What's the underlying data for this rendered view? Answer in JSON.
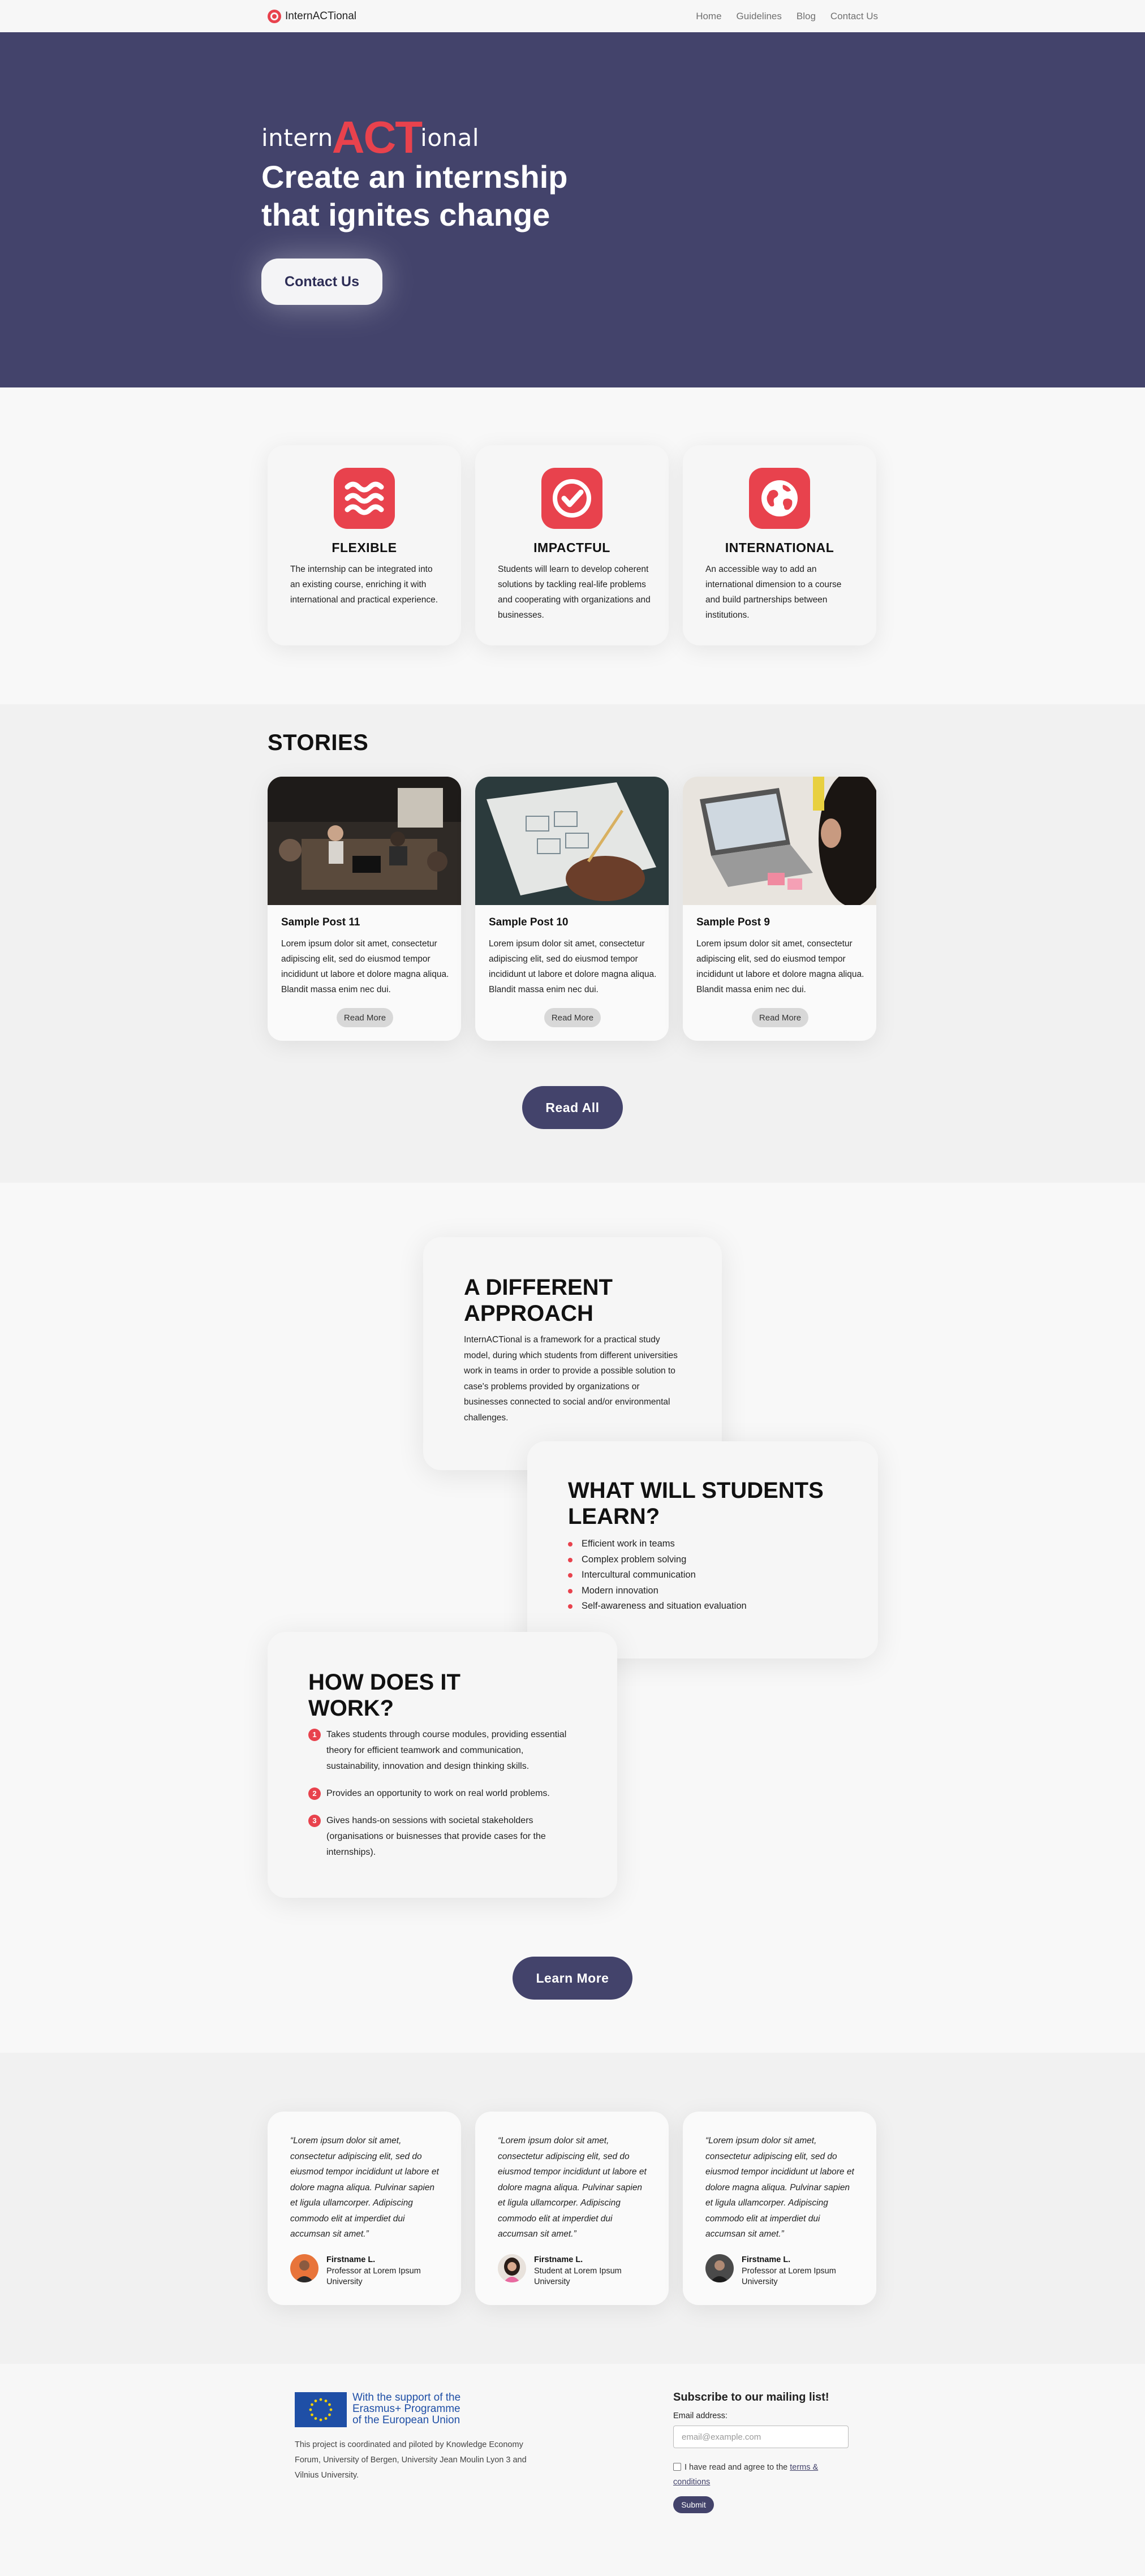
{
  "nav": {
    "brand": "InternACTional",
    "links": [
      "Home",
      "Guidelines",
      "Blog",
      "Contact Us"
    ]
  },
  "hero": {
    "brand_left": "intern",
    "brand_mid": "ACT",
    "brand_right": "ional",
    "title": "Create an internship that ignites change",
    "cta_label": "Contact Us"
  },
  "features": [
    {
      "icon": "waves-icon",
      "title": "FLEXIBLE",
      "text": "The internship can be integrated into an existing course, enriching it with international and practical experience."
    },
    {
      "icon": "check-badge-icon",
      "title": "IMPACTFUL",
      "text": "Students will learn to develop coherent solutions by tackling real-life problems and cooperating with organizations and businesses."
    },
    {
      "icon": "globe-icon",
      "title": "INTERNATIONAL",
      "text": "An accessible way to add an international dimension to a course and build partnerships between institutions."
    }
  ],
  "stories": {
    "title": "STORIES",
    "posts": [
      {
        "title": "Sample Post 11",
        "text": "Lorem ipsum dolor sit amet, consectetur adipiscing elit, sed do eiusmod tempor incididunt ut labore et dolore magna aliqua. Blandit massa enim nec dui.",
        "button": "Read More"
      },
      {
        "title": "Sample Post 10",
        "text": "Lorem ipsum dolor sit amet, consectetur adipiscing elit, sed do eiusmod tempor incididunt ut labore et dolore magna aliqua. Blandit massa enim nec dui.",
        "button": "Read More"
      },
      {
        "title": "Sample Post 9",
        "text": "Lorem ipsum dolor sit amet, consectetur adipiscing elit, sed do eiusmod tempor incididunt ut labore et dolore magna aliqua. Blandit massa enim nec dui.",
        "button": "Read More"
      }
    ],
    "read_all_label": "Read All"
  },
  "approach": {
    "title": "A DIFFERENT APPROACH",
    "text": "InternACTional is a framework for a practical study model, during which students from different universities work in teams in order to provide a possible solution to case's problems provided by organizations or businesses connected to social and/or environmental challenges."
  },
  "learn": {
    "title": "WHAT WILL STUDENTS LEARN?",
    "items": [
      "Efficient work in teams",
      "Complex problem solving",
      "Intercultural communication",
      "Modern innovation",
      "Self-awareness and situation evaluation"
    ]
  },
  "how": {
    "title": "HOW DOES IT WORK?",
    "steps": [
      {
        "num": "1",
        "text": "Takes students through course modules, providing essential theory for efficient teamwork and communication, sustainability, innovation and design thinking skills."
      },
      {
        "num": "2",
        "text": "Provides an opportunity to work on real world problems."
      },
      {
        "num": "3",
        "text": "Gives hands-on sessions with societal stakeholders (organisations or buisnesses that provide cases for the internships)."
      }
    ],
    "learn_more_label": "Learn More"
  },
  "testimonials": [
    {
      "quote": "“Lorem ipsum dolor sit amet, consectetur adipiscing elit, sed do eiusmod tempor incididunt ut labore et dolore magna aliqua. Pulvinar sapien et ligula ullamcorper. Adipiscing commodo elit at imperdiet dui accumsan sit amet.”",
      "name": "Firstname L.",
      "role": "Professor at Lorem Ipsum University"
    },
    {
      "quote": "“Lorem ipsum dolor sit amet, consectetur adipiscing elit, sed do eiusmod tempor incididunt ut labore et dolore magna aliqua. Pulvinar sapien et ligula ullamcorper. Adipiscing commodo elit at imperdiet dui accumsan sit amet.”",
      "name": "Firstname L.",
      "role": "Student at Lorem Ipsum University"
    },
    {
      "quote": "“Lorem ipsum dolor sit amet, consectetur adipiscing elit, sed do eiusmod tempor incididunt ut labore et dolore magna aliqua. Pulvinar sapien et ligula ullamcorper. Adipiscing commodo elit at imperdiet dui accumsan sit amet.”",
      "name": "Firstname L.",
      "role": "Professor at Lorem Ipsum University"
    }
  ],
  "footer": {
    "eu_line1": "With the support of the",
    "eu_line2": "Erasmus+ Programme",
    "eu_line3": "of the European Union",
    "description": "This project is coordinated and piloted by Knowledge Economy Forum, University of Bergen, University Jean Moulin Lyon 3 and Vilnius University.",
    "subscribe_title": "Subscribe to our mailing list!",
    "email_label": "Email address:",
    "email_placeholder": "email@example.com",
    "consent_text": "I have read and agree to the",
    "terms_link": "terms & conditions",
    "submit_label": "Submit"
  },
  "colors": {
    "accent": "#e8424d",
    "primary": "#43436b"
  }
}
